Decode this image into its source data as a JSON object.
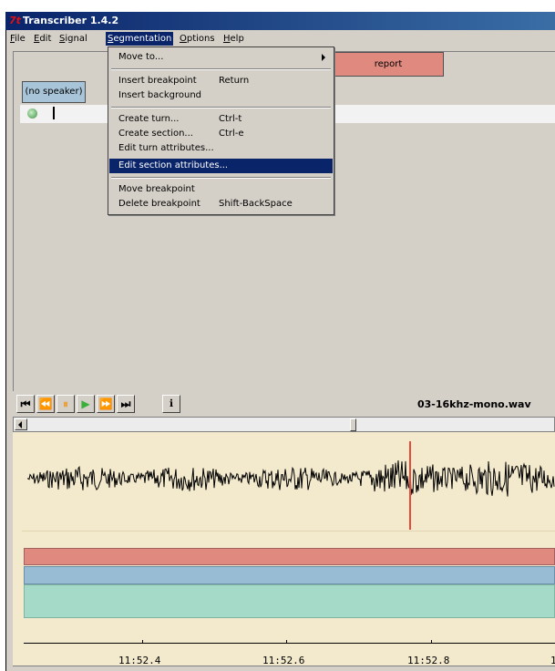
{
  "window": {
    "title": "Transcriber 1.4.2",
    "icon": "transcriber-logo-icon"
  },
  "menubar": {
    "items": [
      {
        "label": "File",
        "mnemonic": "F",
        "rest": "ile"
      },
      {
        "label": "Edit",
        "mnemonic": "E",
        "rest": "dit"
      },
      {
        "label": "Signal",
        "mnemonic": "S",
        "rest": "ignal"
      },
      {
        "label": "Segmentation",
        "mnemonic": "S",
        "rest": "egmentation"
      },
      {
        "label": "Options",
        "mnemonic": "O",
        "rest": "ptions"
      },
      {
        "label": "Help",
        "mnemonic": "H",
        "rest": "elp"
      }
    ],
    "active": "Segmentation"
  },
  "dropdown": {
    "items": [
      {
        "label": "Move to...",
        "shortcut": "",
        "submenu": true
      },
      {
        "label": "Insert breakpoint",
        "shortcut": "Return"
      },
      {
        "label": "Insert background",
        "shortcut": ""
      },
      {
        "label": "Create turn...",
        "shortcut": "Ctrl-t"
      },
      {
        "label": "Create section...",
        "shortcut": "Ctrl-e"
      },
      {
        "label": "Edit turn attributes...",
        "shortcut": ""
      },
      {
        "label": "Edit section attributes...",
        "shortcut": "",
        "highlighted": true
      },
      {
        "label": "Move breakpoint",
        "shortcut": ""
      },
      {
        "label": "Delete breakpoint",
        "shortcut": "Shift-BackSpace"
      }
    ]
  },
  "editor": {
    "section_button": "report",
    "speaker_button": "(no speaker)",
    "segment_icon": "segment-dot-icon"
  },
  "toolbar": {
    "buttons": [
      {
        "name": "skip-to-start-button",
        "icon": "skip-back-icon",
        "glyph": "⏮"
      },
      {
        "name": "rewind-button",
        "icon": "rewind-icon",
        "glyph": "⏪"
      },
      {
        "name": "pause-button",
        "icon": "pause-icon",
        "glyph": "⏸"
      },
      {
        "name": "play-button",
        "icon": "play-icon",
        "glyph": "▶"
      },
      {
        "name": "fast-forward-button",
        "icon": "fast-forward-icon",
        "glyph": "⏩"
      },
      {
        "name": "skip-to-end-button",
        "icon": "skip-forward-icon",
        "glyph": "⏭"
      },
      {
        "name": "info-button",
        "icon": "info-icon",
        "glyph": "ℹ"
      }
    ],
    "filename": "03-16khz-mono.wav"
  },
  "timeline": {
    "tick_labels": [
      "11:52.4",
      "11:52.6",
      "11:52.8",
      "1"
    ]
  },
  "colors": {
    "section_segment": "#e08a7f",
    "speaker_segment": "#97bcd4",
    "text_segment": "#a5d9c8",
    "signal_background": "#f3e9cc",
    "playhead": "#e84a3a",
    "selection": "#0a246a"
  }
}
